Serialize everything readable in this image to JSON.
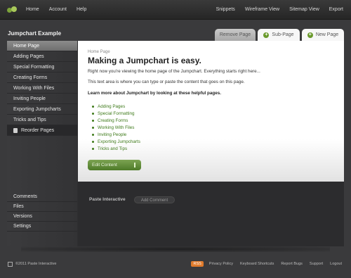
{
  "topnav": {
    "left": [
      "Home",
      "Account",
      "Help"
    ],
    "right": [
      "Snippets",
      "Wireframe View",
      "Sitemap View",
      "Export"
    ]
  },
  "project": {
    "title": "Jumpchart Example"
  },
  "tabs": {
    "remove": "Remove Page",
    "sub": "Sub-Page",
    "new": "New Page"
  },
  "sidebar": {
    "items": [
      "Home Page",
      "Adding Pages",
      "Special Formatting",
      "Creating Forms",
      "Working With Files",
      "Inviting People",
      "Exporting Jumpcharts",
      "Tricks and Tips"
    ],
    "reorder": "Reorder Pages",
    "lower": [
      "Comments",
      "Files",
      "Versions",
      "Settings"
    ]
  },
  "main": {
    "breadcrumb": "Home Page",
    "heading": "Making a Jumpchart is easy.",
    "p1": "Right now you're viewing the home page of the Jumpchart. Everything starts right here...",
    "p2": "This text area is where you can type or paste the content that goes on this page.",
    "p3": "Learn more about Jumpchart by looking at these helpful pages.",
    "links": [
      "Adding Pages",
      "Special Formatting",
      "Creating Forms",
      "Working With Files",
      "Inviting People",
      "Exporting Jumpcharts",
      "Tricks and Tips"
    ],
    "edit_button": "Edit Content"
  },
  "comments": {
    "author": "Paste Interactive",
    "add_button": "Add Comment"
  },
  "footer": {
    "copyright": "©2011 Paste Interactive",
    "rss": "RSS",
    "links": [
      "Privacy Policy",
      "Keyboard Shortcuts",
      "Report Bugs",
      "Support",
      "Logout"
    ]
  },
  "colors": {
    "accent": "#5f8f2e",
    "link": "#3e7a1a"
  }
}
